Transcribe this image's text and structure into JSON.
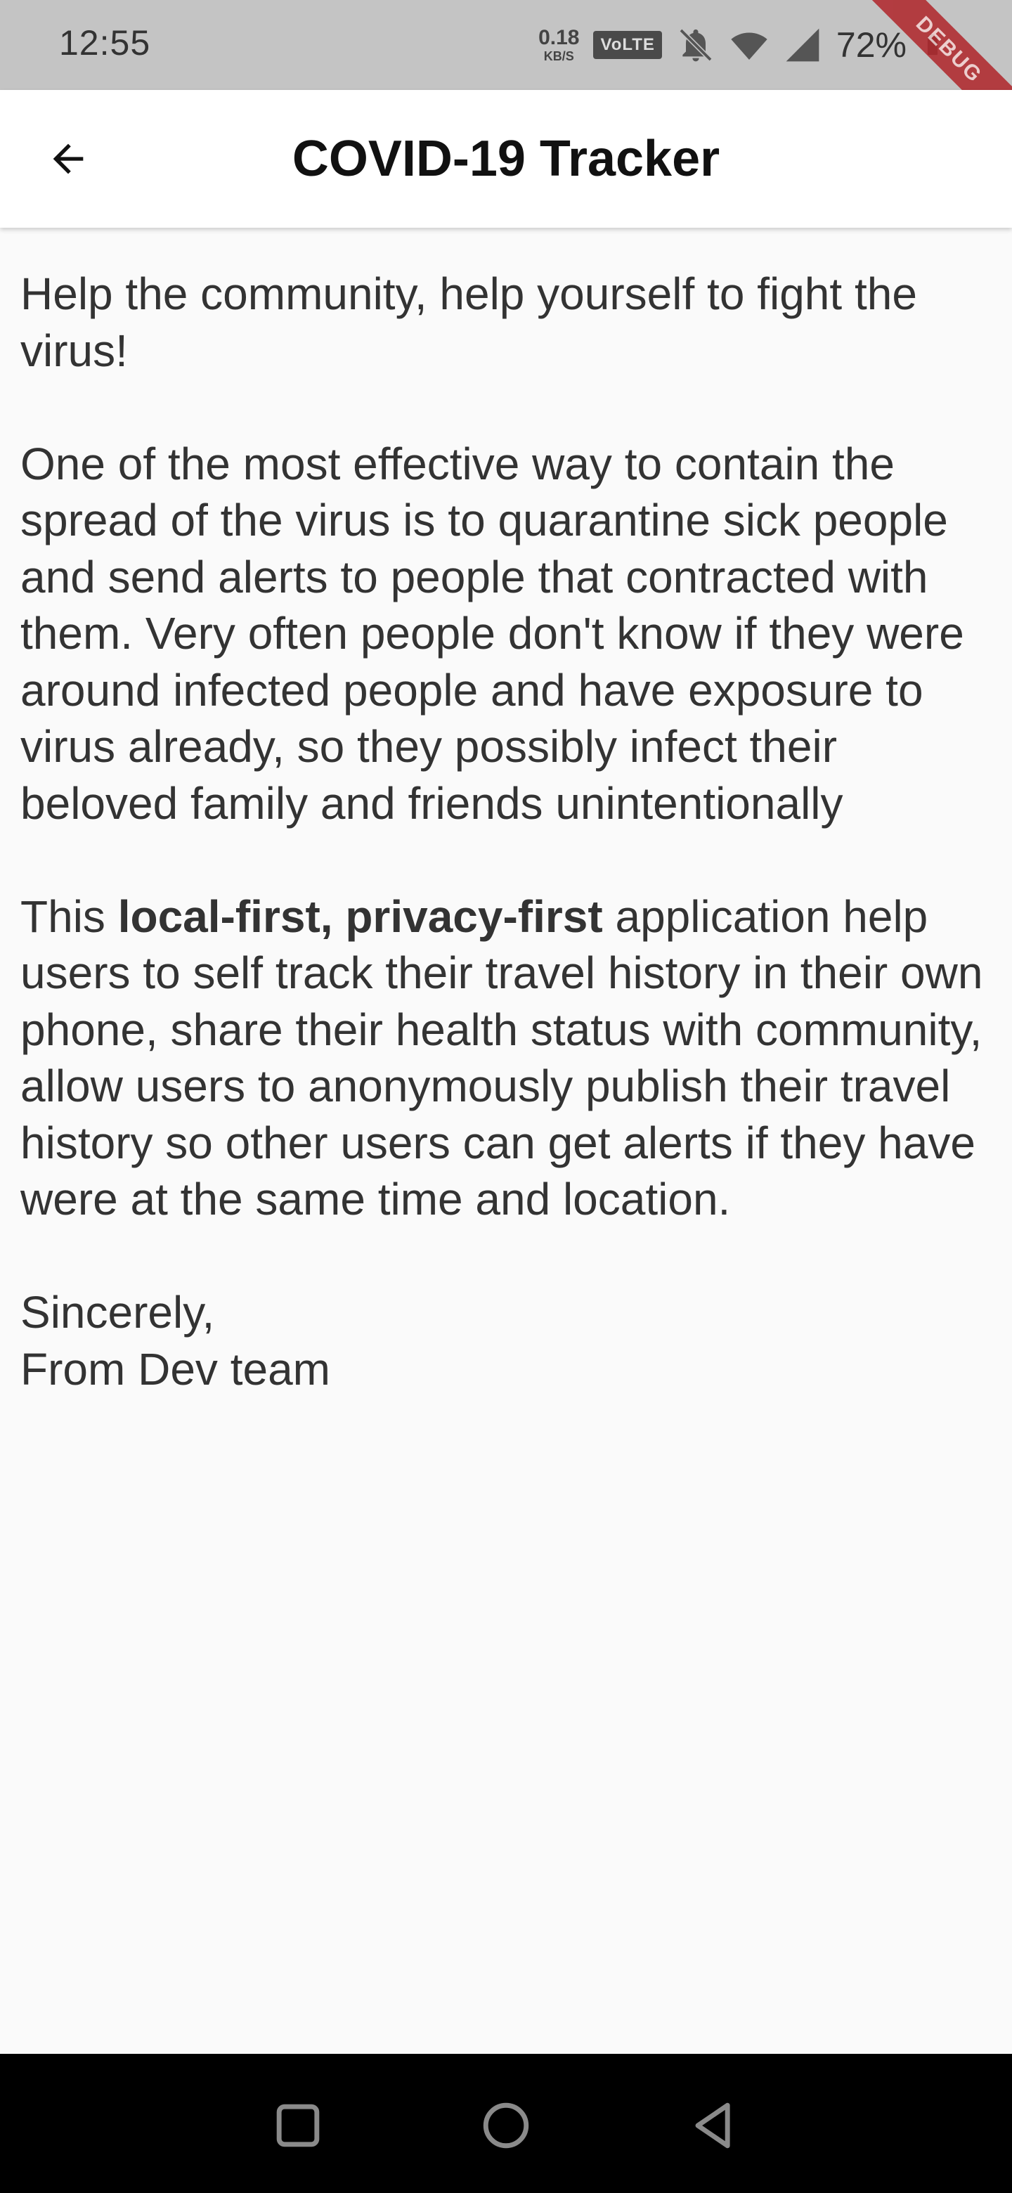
{
  "status_bar": {
    "time": "12:55",
    "speed_value": "0.18",
    "speed_unit": "KB/S",
    "network_badge": "VoLTE",
    "battery_percent": "72%",
    "debug_label": "DEBUG",
    "icons": [
      "mute-bell-icon",
      "wifi-icon",
      "signal-icon",
      "battery-icon"
    ]
  },
  "app_bar": {
    "title": "COVID-19 Tracker",
    "back_icon": "arrow-left-icon"
  },
  "content": {
    "intro": "Help the community, help yourself to fight the virus!",
    "paragraph1": "One of the most effective way to contain the spread of the virus is to quarantine sick people and send alerts to people that contracted with them. Very often people don't know if they were around infected people and have exposure to virus already, so they possibly infect their beloved family and friends unintentionally",
    "paragraph2_before": "This ",
    "paragraph2_bold": "local-first, privacy-first",
    "paragraph2_after": " application help users to self track their travel history in their own phone, share their health status with community, allow users to anonymously publish their travel history so other users can get alerts if they have were at the same time and location.",
    "signoff": "Sincerely,",
    "signature": "From Dev team"
  },
  "nav_bar": {
    "buttons": [
      "recents-square-icon",
      "home-circle-icon",
      "back-triangle-icon"
    ]
  },
  "colors": {
    "status_bar_bg": "#c4c4c4",
    "app_bar_bg": "#ffffff",
    "page_bg": "#fafafa",
    "text": "#333333",
    "debug_ribbon": "#b0252a",
    "nav_bar_bg": "#000000"
  }
}
